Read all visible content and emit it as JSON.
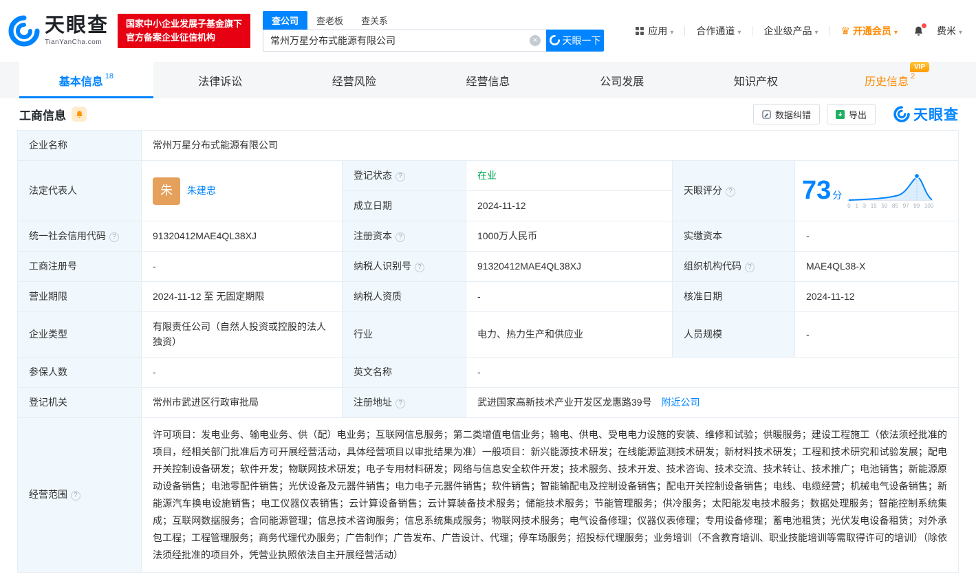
{
  "brand": {
    "name": "天眼查",
    "domain": "TianYanCha.com",
    "badge_line1": "国家中小企业发展子基金旗下",
    "badge_line2": "官方备案企业征信机构"
  },
  "search": {
    "tab_company": "查公司",
    "tab_boss": "查老板",
    "tab_relation": "查关系",
    "value": "常州万星分布式能源有限公司",
    "button_label": "天眼一下"
  },
  "top_nav": {
    "apps": "应用",
    "cooperation": "合作通道",
    "enterprise": "企业级产品",
    "vip": "开通会员",
    "user": "费米"
  },
  "main_tabs": [
    {
      "label": "基本信息",
      "count": "18"
    },
    {
      "label": "法律诉讼"
    },
    {
      "label": "经营风险"
    },
    {
      "label": "经营信息"
    },
    {
      "label": "公司发展"
    },
    {
      "label": "知识产权"
    },
    {
      "label": "历史信息",
      "count": "2",
      "vip": "VIP"
    }
  ],
  "section": {
    "title": "工商信息",
    "correction_label": "数据纠错",
    "export_label": "导出",
    "brand_label": "天眼查"
  },
  "table": {
    "company_name": {
      "label": "企业名称",
      "value": "常州万星分布式能源有限公司"
    },
    "legal_rep": {
      "label": "法定代表人",
      "avatar": "朱",
      "name": "朱建忠"
    },
    "reg_status": {
      "label": "登记状态",
      "value": "在业"
    },
    "establish_date": {
      "label": "成立日期",
      "value": "2024-11-12"
    },
    "score": {
      "label": "天眼评分",
      "value": "73",
      "unit": "分",
      "axis": [
        "0",
        "1",
        "3",
        "15",
        "50",
        "85",
        "97",
        "99",
        "100"
      ]
    },
    "credit_code": {
      "label": "统一社会信用代码",
      "value": "91320412MAE4QL38XJ"
    },
    "reg_capital": {
      "label": "注册资本",
      "value": "1000万人民币"
    },
    "paid_capital": {
      "label": "实缴资本",
      "value": "-"
    },
    "reg_number": {
      "label": "工商注册号",
      "value": "-"
    },
    "taxpayer_id": {
      "label": "纳税人识别号",
      "value": "91320412MAE4QL38XJ"
    },
    "org_code": {
      "label": "组织机构代码",
      "value": "MAE4QL38-X"
    },
    "business_term": {
      "label": "营业期限",
      "value": "2024-11-12 至 无固定期限"
    },
    "taxpayer_qualify": {
      "label": "纳税人资质",
      "value": "-"
    },
    "approval_date": {
      "label": "核准日期",
      "value": "2024-11-12"
    },
    "company_type": {
      "label": "企业类型",
      "value": "有限责任公司（自然人投资或控股的法人独资）"
    },
    "industry": {
      "label": "行业",
      "value": "电力、热力生产和供应业"
    },
    "staff_size": {
      "label": "人员规模",
      "value": "-"
    },
    "insured_count": {
      "label": "参保人数",
      "value": "-"
    },
    "english_name": {
      "label": "英文名称",
      "value": "-"
    },
    "reg_authority": {
      "label": "登记机关",
      "value": "常州市武进区行政审批局"
    },
    "reg_address": {
      "label": "注册地址",
      "value": "武进国家高新技术产业开发区龙惠路39号",
      "nearby_link": "附近公司"
    },
    "business_scope": {
      "label": "经营范围",
      "value": "许可项目：发电业务、输电业务、供（配）电业务；互联网信息服务；第二类增值电信业务；输电、供电、受电电力设施的安装、维修和试验；供暖服务；建设工程施工（依法须经批准的项目，经相关部门批准后方可开展经营活动，具体经营项目以审批结果为准）一般项目：新兴能源技术研发；在线能源监测技术研发；新材料技术研发；工程和技术研究和试验发展；配电开关控制设备研发；软件开发；物联网技术研发；电子专用材料研发；网络与信息安全软件开发；技术服务、技术开发、技术咨询、技术交流、技术转让、技术推广；电池销售；新能源原动设备销售；电池零配件销售；光伏设备及元器件销售；电力电子元器件销售；软件销售；智能输配电及控制设备销售；配电开关控制设备销售；电线、电缆经营；机械电气设备销售；新能源汽车换电设施销售；电工仪器仪表销售；云计算设备销售；云计算装备技术服务；储能技术服务；节能管理服务；供冷服务；太阳能发电技术服务；数据处理服务；智能控制系统集成；互联网数据服务；合同能源管理；信息技术咨询服务；信息系统集成服务；物联网技术服务；电气设备修理；仪器仪表修理；专用设备修理；蓄电池租赁；光伏发电设备租赁；对外承包工程；工程管理服务；商务代理代办服务；广告制作；广告发布、广告设计、代理；停车场服务；招投标代理服务；业务培训（不含教育培训、职业技能培训等需取得许可的培训）（除依法须经批准的项目外，凭营业执照依法自主开展经营活动）"
    }
  }
}
